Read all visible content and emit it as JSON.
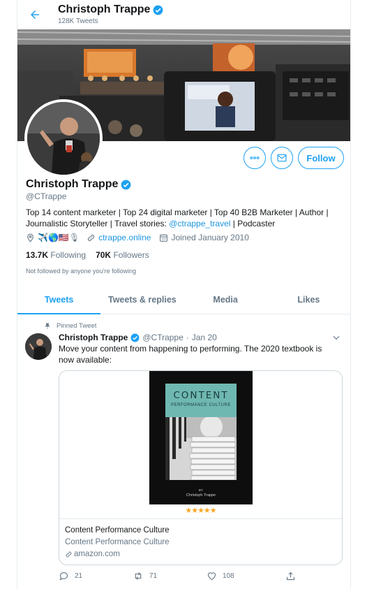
{
  "header": {
    "back_icon": "arrow-left-icon",
    "name": "Christoph Trappe",
    "tweet_count": "128K Tweets"
  },
  "profile": {
    "name": "Christoph Trappe",
    "handle": "@CTrappe",
    "bio_text": "Top 14 content marketer | Top 24 digital marketer | Top 40 B2B Marketer | Author | Journalistic Storyteller | Travel stories: ",
    "bio_link": "@ctrappe_travel",
    "bio_tail": " | Podcaster",
    "location_emojis": "✈️🌎🇺🇸🎙",
    "website": "ctrappe.online",
    "joined": "Joined January 2010",
    "following_count": "13.7K",
    "following_label": "Following",
    "followers_count": "70K",
    "followers_label": "Followers",
    "not_followed": "Not followed by anyone you’re following",
    "follow_label": "Follow"
  },
  "tabs": [
    {
      "label": "Tweets",
      "active": true
    },
    {
      "label": "Tweets & replies",
      "active": false
    },
    {
      "label": "Media",
      "active": false
    },
    {
      "label": "Likes",
      "active": false
    }
  ],
  "tweet": {
    "pinned_label": "Pinned Tweet",
    "name": "Christoph Trappe",
    "handle": "@CTrappe",
    "sep": "·",
    "date": "Jan 20",
    "text": "Move your content from happening to performing. The 2020 textbook is now available:",
    "card": {
      "book_title": "CONTENT",
      "book_subtitle": "PERFORMANCE CULTURE",
      "book_by": "BY",
      "book_author": "Christoph Trappe",
      "stars": "★★★★★",
      "title": "Content Performance Culture",
      "description": "Content Performance Culture",
      "domain": "amazon.com"
    },
    "replies": "21",
    "retweets": "71",
    "likes": "108"
  },
  "colors": {
    "accent": "#1da1f2",
    "link": "#1b95e0",
    "muted": "#657786",
    "border": "#e6ecf0"
  }
}
